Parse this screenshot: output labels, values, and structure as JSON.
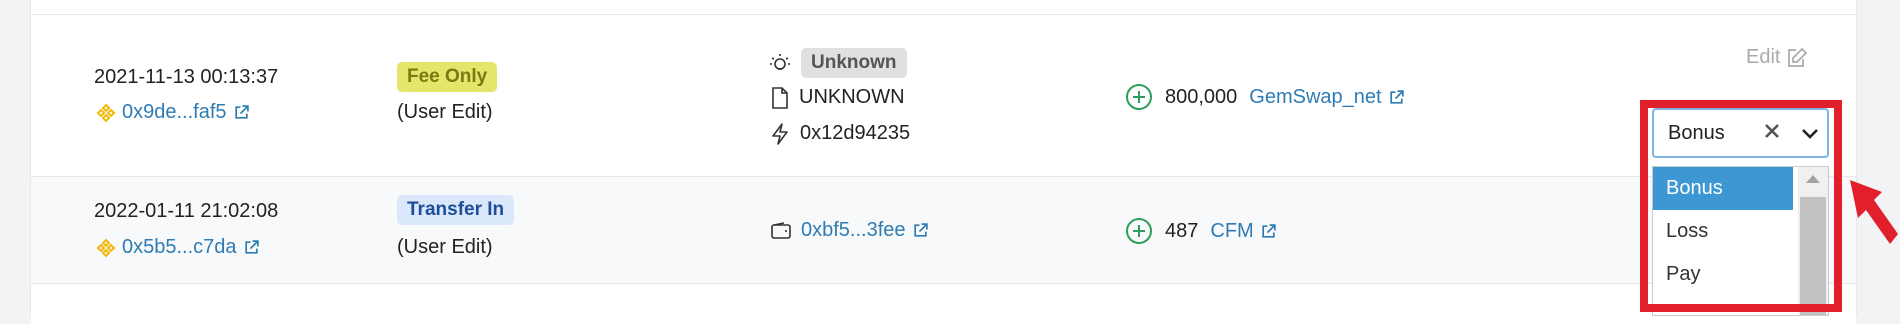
{
  "rows": [
    {
      "date": "2021-11-13 00:13:37",
      "hash": "0x9de...faf5",
      "type_badge": "Fee Only",
      "type_note": "(User Edit)",
      "category": "Unknown",
      "protocol": "UNKNOWN",
      "method": "0x12d94235",
      "amount": "800,000",
      "token": "GemSwap_net",
      "edit_label": "Edit"
    },
    {
      "date": "2022-01-11 21:02:08",
      "hash": "0x5b5...c7da",
      "type_badge": "Transfer In",
      "type_note": "(User Edit)",
      "counterparty": "0xbf5...3fee",
      "amount": "487",
      "token": "CFM"
    }
  ],
  "select": {
    "value": "Bonus",
    "options": [
      "Bonus",
      "Loss",
      "Pay"
    ]
  },
  "colors": {
    "link": "#2f7cb3",
    "fee_badge": "#e4e56b",
    "transfer_badge": "#dbe7fb",
    "highlight": "#e2202b",
    "selected_option": "#3c97d3",
    "plus_icon": "#2e9d5a"
  }
}
